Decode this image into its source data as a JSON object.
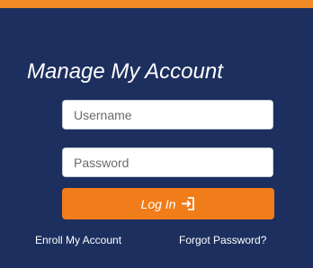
{
  "colors": {
    "accent": "#f08a24",
    "panel_background": "#1c2f5e",
    "button_background": "#f07d1a",
    "text_on_dark": "#ffffff"
  },
  "account": {
    "title": "Manage My Account",
    "username_placeholder": "Username",
    "password_placeholder": "Password",
    "login_label": "Log In",
    "login_icon": "sign-in-icon",
    "enroll_link": "Enroll My Account",
    "forgot_link": "Forgot Password?"
  }
}
